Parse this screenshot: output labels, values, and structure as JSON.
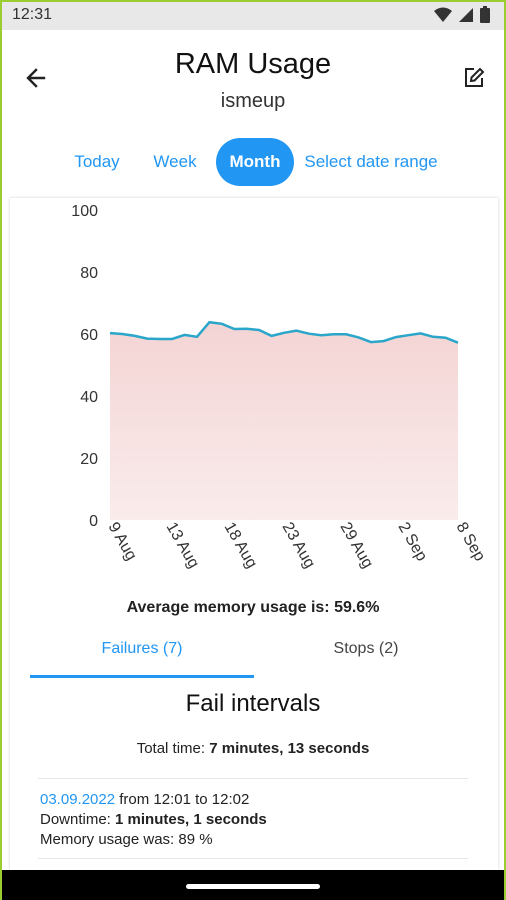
{
  "status": {
    "time": "12:31"
  },
  "header": {
    "title": "RAM Usage",
    "subtitle": "ismeup"
  },
  "tabs": [
    {
      "label": "Today"
    },
    {
      "label": "Week"
    },
    {
      "label": "Month",
      "active": true
    },
    {
      "label": "Select date range"
    }
  ],
  "chart_data": {
    "type": "area",
    "ylim": [
      0,
      100
    ],
    "yticks": [
      "0",
      "20",
      "40",
      "60",
      "80",
      "100"
    ],
    "xticks": [
      "9 Aug",
      "13 Aug",
      "18 Aug",
      "23 Aug",
      "29 Aug",
      "2 Sep",
      "8 Sep"
    ],
    "values": [
      60.3,
      60.0,
      59.4,
      58.5,
      58.4,
      58.4,
      59.7,
      59.1,
      63.8,
      63.3,
      61.6,
      61.7,
      61.3,
      59.4,
      60.4,
      61.1,
      60.1,
      59.6,
      59.9,
      59.9,
      58.9,
      57.4,
      57.7,
      59.0,
      59.6,
      60.2,
      59.1,
      58.8,
      57.2
    ],
    "line_color": "#29a6c9",
    "fill_color": "#f4d4d4"
  },
  "average": "Average memory usage is: 59.6%",
  "subtabs": {
    "failures": "Failures (7)",
    "stops": "Stops (2)"
  },
  "fail": {
    "title": "Fail intervals",
    "total_label": "Total time:",
    "total_value": "7 minutes, 13 seconds"
  },
  "intervals": [
    {
      "date": "03.09.2022",
      "range": "from 12:01 to 12:02",
      "downtime_label": "Downtime:",
      "downtime_value": "1 minutes, 1 seconds",
      "memory": "Memory usage was: 89 %"
    }
  ]
}
